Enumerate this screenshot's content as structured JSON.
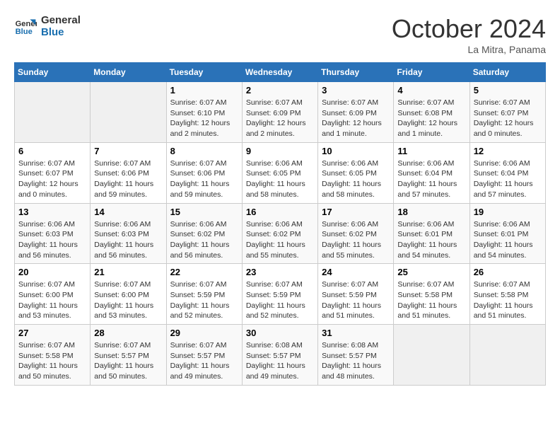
{
  "header": {
    "logo_line1": "General",
    "logo_line2": "Blue",
    "month_title": "October 2024",
    "subtitle": "La Mitra, Panama"
  },
  "days_of_week": [
    "Sunday",
    "Monday",
    "Tuesday",
    "Wednesday",
    "Thursday",
    "Friday",
    "Saturday"
  ],
  "weeks": [
    [
      {
        "day": "",
        "empty": true
      },
      {
        "day": "",
        "empty": true
      },
      {
        "day": "1",
        "sunrise": "Sunrise: 6:07 AM",
        "sunset": "Sunset: 6:10 PM",
        "daylight": "Daylight: 12 hours and 2 minutes."
      },
      {
        "day": "2",
        "sunrise": "Sunrise: 6:07 AM",
        "sunset": "Sunset: 6:09 PM",
        "daylight": "Daylight: 12 hours and 2 minutes."
      },
      {
        "day": "3",
        "sunrise": "Sunrise: 6:07 AM",
        "sunset": "Sunset: 6:09 PM",
        "daylight": "Daylight: 12 hours and 1 minute."
      },
      {
        "day": "4",
        "sunrise": "Sunrise: 6:07 AM",
        "sunset": "Sunset: 6:08 PM",
        "daylight": "Daylight: 12 hours and 1 minute."
      },
      {
        "day": "5",
        "sunrise": "Sunrise: 6:07 AM",
        "sunset": "Sunset: 6:07 PM",
        "daylight": "Daylight: 12 hours and 0 minutes."
      }
    ],
    [
      {
        "day": "6",
        "sunrise": "Sunrise: 6:07 AM",
        "sunset": "Sunset: 6:07 PM",
        "daylight": "Daylight: 12 hours and 0 minutes."
      },
      {
        "day": "7",
        "sunrise": "Sunrise: 6:07 AM",
        "sunset": "Sunset: 6:06 PM",
        "daylight": "Daylight: 11 hours and 59 minutes."
      },
      {
        "day": "8",
        "sunrise": "Sunrise: 6:07 AM",
        "sunset": "Sunset: 6:06 PM",
        "daylight": "Daylight: 11 hours and 59 minutes."
      },
      {
        "day": "9",
        "sunrise": "Sunrise: 6:06 AM",
        "sunset": "Sunset: 6:05 PM",
        "daylight": "Daylight: 11 hours and 58 minutes."
      },
      {
        "day": "10",
        "sunrise": "Sunrise: 6:06 AM",
        "sunset": "Sunset: 6:05 PM",
        "daylight": "Daylight: 11 hours and 58 minutes."
      },
      {
        "day": "11",
        "sunrise": "Sunrise: 6:06 AM",
        "sunset": "Sunset: 6:04 PM",
        "daylight": "Daylight: 11 hours and 57 minutes."
      },
      {
        "day": "12",
        "sunrise": "Sunrise: 6:06 AM",
        "sunset": "Sunset: 6:04 PM",
        "daylight": "Daylight: 11 hours and 57 minutes."
      }
    ],
    [
      {
        "day": "13",
        "sunrise": "Sunrise: 6:06 AM",
        "sunset": "Sunset: 6:03 PM",
        "daylight": "Daylight: 11 hours and 56 minutes."
      },
      {
        "day": "14",
        "sunrise": "Sunrise: 6:06 AM",
        "sunset": "Sunset: 6:03 PM",
        "daylight": "Daylight: 11 hours and 56 minutes."
      },
      {
        "day": "15",
        "sunrise": "Sunrise: 6:06 AM",
        "sunset": "Sunset: 6:02 PM",
        "daylight": "Daylight: 11 hours and 56 minutes."
      },
      {
        "day": "16",
        "sunrise": "Sunrise: 6:06 AM",
        "sunset": "Sunset: 6:02 PM",
        "daylight": "Daylight: 11 hours and 55 minutes."
      },
      {
        "day": "17",
        "sunrise": "Sunrise: 6:06 AM",
        "sunset": "Sunset: 6:02 PM",
        "daylight": "Daylight: 11 hours and 55 minutes."
      },
      {
        "day": "18",
        "sunrise": "Sunrise: 6:06 AM",
        "sunset": "Sunset: 6:01 PM",
        "daylight": "Daylight: 11 hours and 54 minutes."
      },
      {
        "day": "19",
        "sunrise": "Sunrise: 6:06 AM",
        "sunset": "Sunset: 6:01 PM",
        "daylight": "Daylight: 11 hours and 54 minutes."
      }
    ],
    [
      {
        "day": "20",
        "sunrise": "Sunrise: 6:07 AM",
        "sunset": "Sunset: 6:00 PM",
        "daylight": "Daylight: 11 hours and 53 minutes."
      },
      {
        "day": "21",
        "sunrise": "Sunrise: 6:07 AM",
        "sunset": "Sunset: 6:00 PM",
        "daylight": "Daylight: 11 hours and 53 minutes."
      },
      {
        "day": "22",
        "sunrise": "Sunrise: 6:07 AM",
        "sunset": "Sunset: 5:59 PM",
        "daylight": "Daylight: 11 hours and 52 minutes."
      },
      {
        "day": "23",
        "sunrise": "Sunrise: 6:07 AM",
        "sunset": "Sunset: 5:59 PM",
        "daylight": "Daylight: 11 hours and 52 minutes."
      },
      {
        "day": "24",
        "sunrise": "Sunrise: 6:07 AM",
        "sunset": "Sunset: 5:59 PM",
        "daylight": "Daylight: 11 hours and 51 minutes."
      },
      {
        "day": "25",
        "sunrise": "Sunrise: 6:07 AM",
        "sunset": "Sunset: 5:58 PM",
        "daylight": "Daylight: 11 hours and 51 minutes."
      },
      {
        "day": "26",
        "sunrise": "Sunrise: 6:07 AM",
        "sunset": "Sunset: 5:58 PM",
        "daylight": "Daylight: 11 hours and 51 minutes."
      }
    ],
    [
      {
        "day": "27",
        "sunrise": "Sunrise: 6:07 AM",
        "sunset": "Sunset: 5:58 PM",
        "daylight": "Daylight: 11 hours and 50 minutes."
      },
      {
        "day": "28",
        "sunrise": "Sunrise: 6:07 AM",
        "sunset": "Sunset: 5:57 PM",
        "daylight": "Daylight: 11 hours and 50 minutes."
      },
      {
        "day": "29",
        "sunrise": "Sunrise: 6:07 AM",
        "sunset": "Sunset: 5:57 PM",
        "daylight": "Daylight: 11 hours and 49 minutes."
      },
      {
        "day": "30",
        "sunrise": "Sunrise: 6:08 AM",
        "sunset": "Sunset: 5:57 PM",
        "daylight": "Daylight: 11 hours and 49 minutes."
      },
      {
        "day": "31",
        "sunrise": "Sunrise: 6:08 AM",
        "sunset": "Sunset: 5:57 PM",
        "daylight": "Daylight: 11 hours and 48 minutes."
      },
      {
        "day": "",
        "empty": true
      },
      {
        "day": "",
        "empty": true
      }
    ]
  ]
}
